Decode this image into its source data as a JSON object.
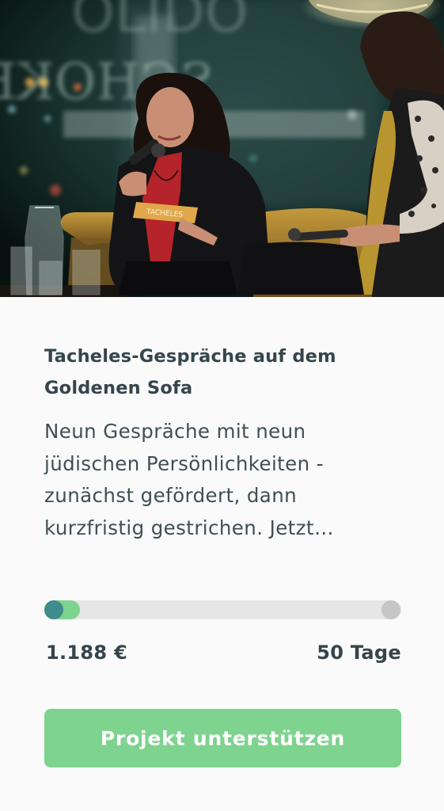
{
  "project": {
    "title": "Tacheles-Gespräche auf dem Goldenen Sofa",
    "description": "Neun Gespräche mit neun jüdischen Persönlichkeiten - zunächst gefördert, dann kurzfristig gestrichen. Jetzt…",
    "image": {
      "subject": "two-women-on-golden-sofa-with-microphones",
      "window_lettering": "SCHOKEN",
      "note_card_text": "TACHELES"
    }
  },
  "funding": {
    "progress_fraction": 0.1,
    "amount": "1.188 €",
    "days_left": "50 Tage"
  },
  "action": {
    "support_label": "Projekt unterstützen"
  },
  "colors": {
    "accent_green": "#7ed38f",
    "progress_start_teal": "#3e8c8c",
    "track_gray": "#e6e6e6",
    "goal_gray": "#c6c6c6",
    "text_dark": "#35454b"
  }
}
